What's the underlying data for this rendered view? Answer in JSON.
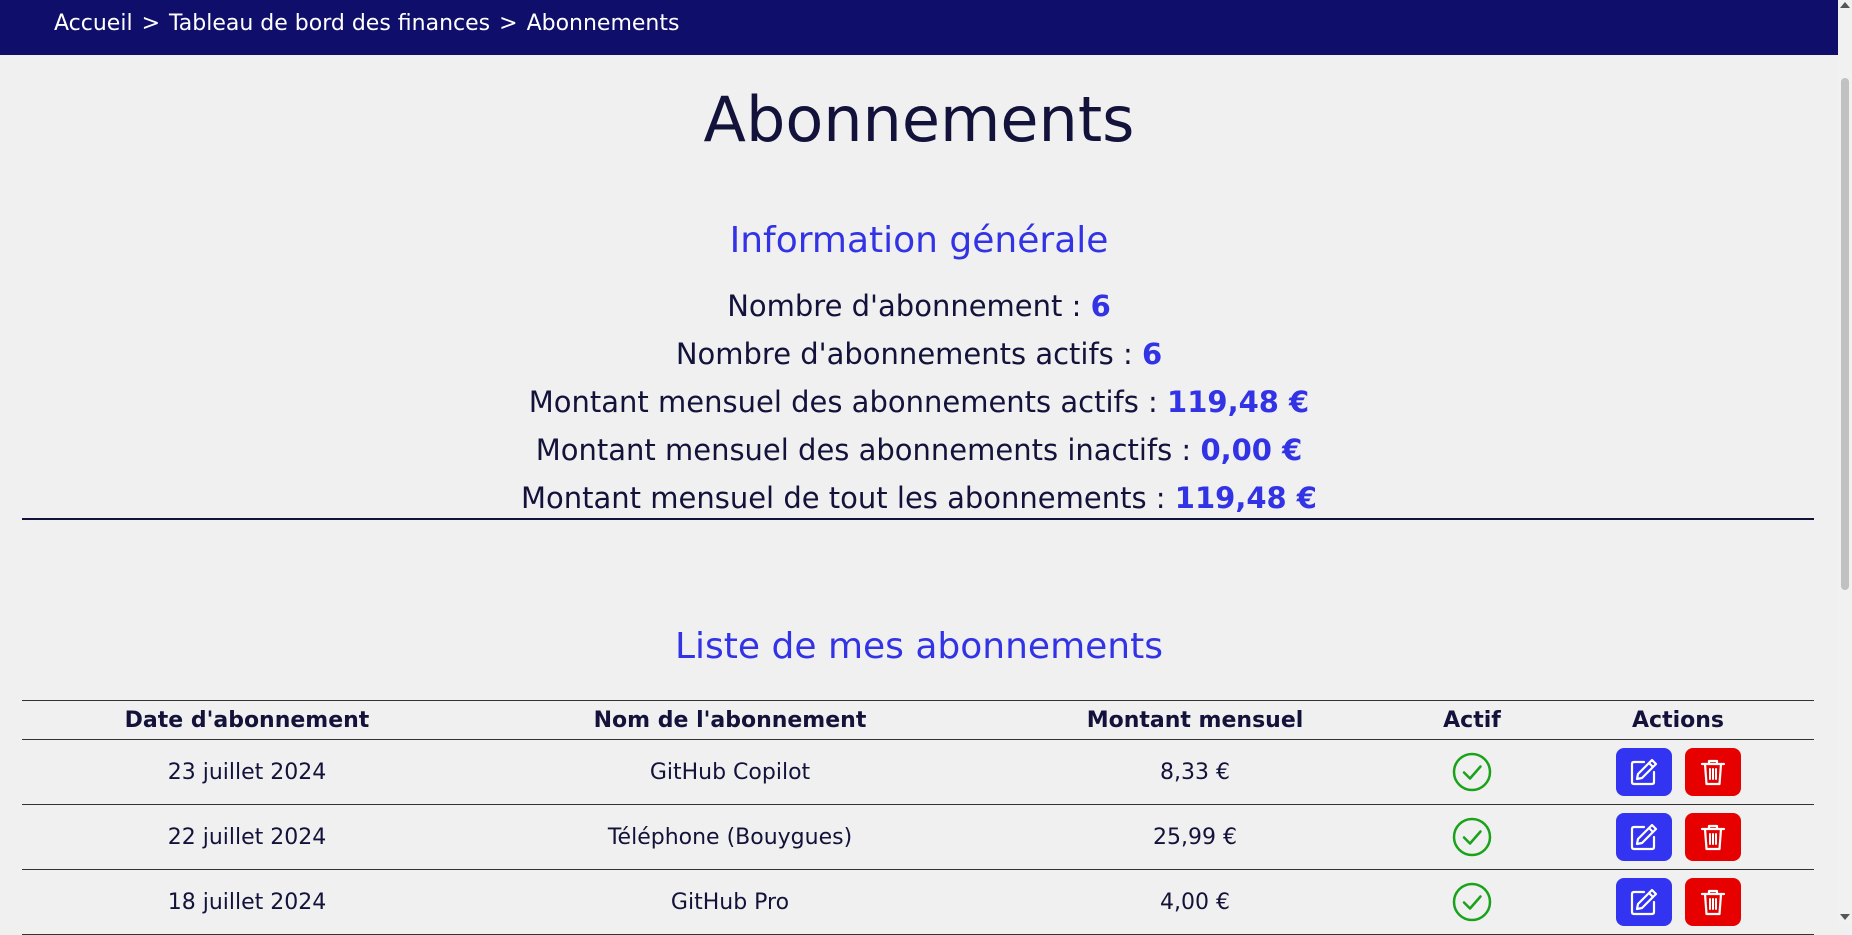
{
  "breadcrumb": {
    "items": [
      "Accueil",
      "Tableau de bord des finances",
      "Abonnements"
    ],
    "separator": ">"
  },
  "page_title": "Abonnements",
  "general_info": {
    "title": "Information générale",
    "lines": [
      {
        "label": "Nombre d'abonnement : ",
        "value": "6"
      },
      {
        "label": "Nombre d'abonnements actifs : ",
        "value": "6"
      },
      {
        "label": "Montant mensuel des abonnements actifs : ",
        "value": "119,48 €"
      },
      {
        "label": "Montant mensuel des abonnements inactifs : ",
        "value": "0,00 €"
      },
      {
        "label": "Montant mensuel de tout les abonnements : ",
        "value": "119,48 €"
      }
    ]
  },
  "list": {
    "title": "Liste de mes abonnements",
    "headers": [
      "Date d'abonnement",
      "Nom de l'abonnement",
      "Montant mensuel",
      "Actif",
      "Actions"
    ],
    "rows": [
      {
        "date": "23 juillet 2024",
        "name": "GitHub Copilot",
        "amount": "8,33 €",
        "active": true
      },
      {
        "date": "22 juillet 2024",
        "name": "Téléphone (Bouygues)",
        "amount": "25,99 €",
        "active": true
      },
      {
        "date": "18 juillet 2024",
        "name": "GitHub Pro",
        "amount": "4,00 €",
        "active": true
      }
    ]
  },
  "icons": {
    "active": "check-circle-icon",
    "edit": "edit-icon",
    "delete": "trash-icon"
  },
  "colors": {
    "navbar": "#0f0f6b",
    "accent": "#3333e6",
    "edit_button": "#3333f2",
    "delete_button": "#e60000",
    "active_check": "#1aa31a"
  }
}
